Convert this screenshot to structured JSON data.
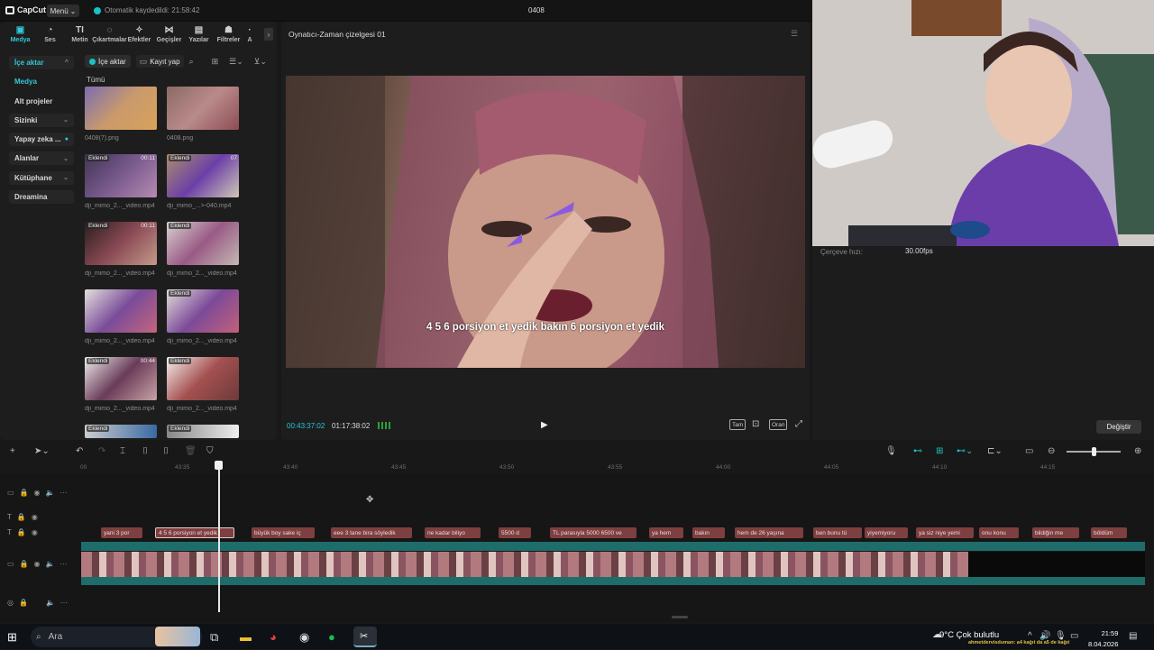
{
  "app": {
    "logo": "CapCut",
    "menu_label": "Menü",
    "saved_status": "Otomatik kaydedildi: 21:58:42",
    "project_name": "0408"
  },
  "tabs": [
    {
      "label": "Medya",
      "icon": "media-icon"
    },
    {
      "label": "Ses",
      "icon": "audio-icon"
    },
    {
      "label": "Metin",
      "icon": "text-icon"
    },
    {
      "label": "Çıkartmalar",
      "icon": "sticker-icon"
    },
    {
      "label": "Efektler",
      "icon": "effects-icon"
    },
    {
      "label": "Geçişler",
      "icon": "transitions-icon"
    },
    {
      "label": "Yazılar",
      "icon": "captions-icon"
    },
    {
      "label": "Filtreler",
      "icon": "filters-icon"
    },
    {
      "label": "A",
      "icon": "adjust-icon"
    }
  ],
  "sidenav": [
    {
      "label": "İçe aktar"
    },
    {
      "label": "Medya"
    },
    {
      "label": "Alt projeler"
    },
    {
      "label": "Sizinki"
    },
    {
      "label": "Yapay zeka ..."
    },
    {
      "label": "Alanlar"
    },
    {
      "label": "Kütüphane"
    },
    {
      "label": "Dreamina"
    }
  ],
  "media_toolbar": {
    "import_label": "İçe aktar",
    "record_label": "Kayıt yap"
  },
  "media_filter": "Tümü",
  "media_items": [
    {
      "name": "0408(7).png",
      "badge": "",
      "duration": ""
    },
    {
      "name": "0408.png",
      "badge": "",
      "duration": ""
    },
    {
      "name": "dji_mimo_2..._video.mp4",
      "badge": "Eklendi",
      "duration": "00:11"
    },
    {
      "name": "dji_mimo_...>-040.mp4",
      "badge": "Eklendi",
      "duration": "07"
    },
    {
      "name": "dji_mimo_2..._video.mp4",
      "badge": "Eklendi",
      "duration": "00:11"
    },
    {
      "name": "dji_mimo_2..._video.mp4",
      "badge": "Eklendi",
      "duration": ""
    },
    {
      "name": "dji_mimo_2..._video.mp4",
      "badge": "",
      "duration": ""
    },
    {
      "name": "dji_mimo_2..._video.mp4",
      "badge": "Eklendi",
      "duration": ""
    },
    {
      "name": "dji_mimo_2..._video.mp4",
      "badge": "Eklendi",
      "duration": "00:44"
    },
    {
      "name": "dji_mimo_2..._video.mp4",
      "badge": "Eklendi",
      "duration": ""
    },
    {
      "name": "",
      "badge": "Eklendi",
      "duration": ""
    },
    {
      "name": "",
      "badge": "Eklendi",
      "duration": ""
    }
  ],
  "player": {
    "title": "Oynatıcı-Zaman çizelgesi 01",
    "subtitle": "4 5 6 porsiyon et yedik bakın 6 porsiyon et yedik",
    "current_time": "00:43:37:02",
    "total_time": "01:17:38:02",
    "controls": {
      "full": "Tam",
      "ratio": "Oran"
    }
  },
  "details": {
    "fps_label": "Çerçeve hızı:",
    "fps_value": "30.00fps",
    "change_label": "Değiştir"
  },
  "ruler_ticks": [
    "00",
    "43:35",
    "43:40",
    "43:45",
    "43:50",
    "43:55",
    "44:00",
    "44:05",
    "44:10",
    "44:15"
  ],
  "caption_clips": [
    "yani 3 por",
    "4 5 6 porsiyon et yedik",
    "büyük boy sake iç",
    "eee 3 tane bira söyledik",
    "ne kadar biliyo",
    "5500 d",
    "TL parasıyla 5000 6500 ve",
    "ya hem",
    "bakın",
    "hem de 26 yaşına",
    "ben bunu tü",
    "yiyemiyoru",
    "ya siz niye yemi",
    "onu konu",
    "bildiğin me",
    "böldüm"
  ],
  "taskbar": {
    "search_placeholder": "Ara",
    "weather": "9°C  Çok bulutlu",
    "ticker": "ahmetdervisduman: a4 kağıt da a5 de kağıt",
    "time": "21:59",
    "date": "8.04.2026"
  },
  "colors": {
    "accent": "#33c7d6",
    "caption_clip": "#7d3f3f",
    "audio_track": "#1f6d6a"
  }
}
